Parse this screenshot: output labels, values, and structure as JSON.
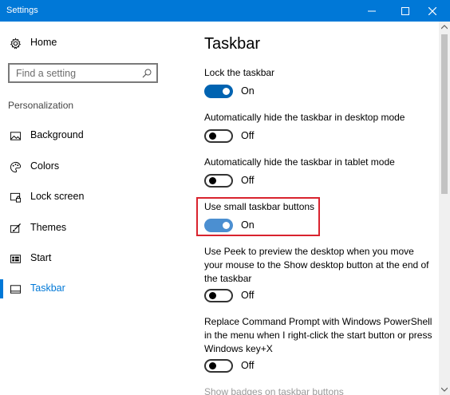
{
  "window": {
    "title": "Settings"
  },
  "sidebar": {
    "home_label": "Home",
    "search_placeholder": "Find a setting",
    "section_label": "Personalization",
    "items": [
      {
        "label": "Background",
        "icon": "picture-icon"
      },
      {
        "label": "Colors",
        "icon": "palette-icon"
      },
      {
        "label": "Lock screen",
        "icon": "lock-screen-icon"
      },
      {
        "label": "Themes",
        "icon": "brush-icon"
      },
      {
        "label": "Start",
        "icon": "start-icon"
      },
      {
        "label": "Taskbar",
        "icon": "taskbar-icon",
        "active": true
      }
    ]
  },
  "main": {
    "title": "Taskbar",
    "settings": [
      {
        "label": "Lock the taskbar",
        "state": "On"
      },
      {
        "label": "Automatically hide the taskbar in desktop mode",
        "state": "Off"
      },
      {
        "label": "Automatically hide the taskbar in tablet mode",
        "state": "Off"
      },
      {
        "label": "Use small taskbar buttons",
        "state": "On",
        "highlighted": true
      },
      {
        "label": "Use Peek to preview the desktop when you move your mouse to the Show desktop button at the end of the taskbar",
        "state": "Off"
      },
      {
        "label": "Replace Command Prompt with Windows PowerShell in the menu when I right-click the start button or press Windows key+X",
        "state": "Off"
      },
      {
        "label": "Show badges on taskbar buttons"
      }
    ]
  },
  "colors": {
    "accent": "#0078d7",
    "highlight_border": "#d9232e"
  }
}
